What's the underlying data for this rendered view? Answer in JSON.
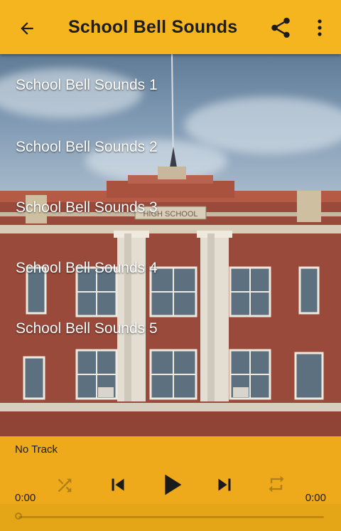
{
  "toolbar": {
    "title": "School Bell Sounds",
    "back_icon": "arrow-left-icon",
    "share_icon": "share-icon",
    "more_icon": "more-vertical-icon"
  },
  "list": {
    "items": [
      {
        "label": "School Bell Sounds 1"
      },
      {
        "label": "School Bell Sounds 2"
      },
      {
        "label": "School Bell Sounds 3"
      },
      {
        "label": "School Bell Sounds 4"
      },
      {
        "label": "School Bell Sounds 5"
      }
    ]
  },
  "background": {
    "sign_text": "HIGH SCHOOL"
  },
  "player": {
    "track": "No Track",
    "elapsed": "0:00",
    "duration": "0:00",
    "progress": 0,
    "shuffle_icon": "shuffle-icon",
    "prev_icon": "skip-previous-icon",
    "play_icon": "play-icon",
    "next_icon": "skip-next-icon",
    "repeat_icon": "repeat-icon"
  },
  "colors": {
    "accent": "#f5b51e",
    "text_dark": "#1c1c1c",
    "list_text": "#ffffff",
    "brick": "#9a4a3a"
  }
}
